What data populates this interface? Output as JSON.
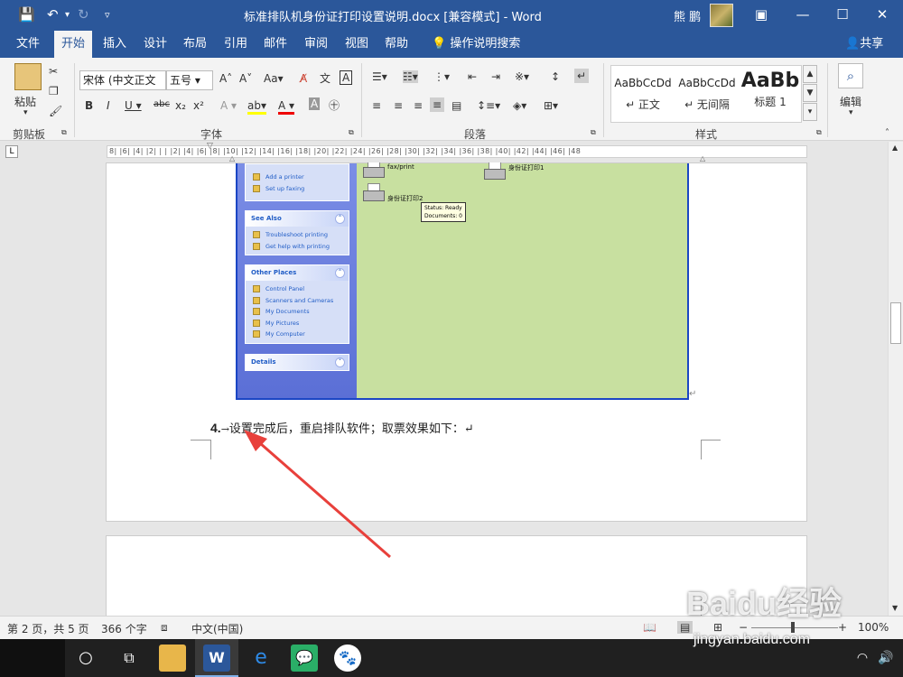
{
  "titlebar": {
    "title": "标准排队机身份证打印设置说明.docx [兼容模式] - Word",
    "user": "熊 鹏",
    "icons": [
      "save-icon",
      "undo-icon",
      "redo-icon",
      "customize-icon",
      "ribbon-display-icon",
      "minimize-icon",
      "maximize-icon",
      "close-icon"
    ]
  },
  "tabs": [
    "文件",
    "开始",
    "插入",
    "设计",
    "布局",
    "引用",
    "邮件",
    "审阅",
    "视图",
    "帮助",
    "操作说明搜索"
  ],
  "share": "共享",
  "ribbon": {
    "clipboard": {
      "paste": "粘贴",
      "label": "剪贴板"
    },
    "font": {
      "name": "宋体 (中文正文",
      "size": "五号",
      "aa": "Aa",
      "label": "字体"
    },
    "paragraph": {
      "label": "段落"
    },
    "styles": {
      "label": "样式",
      "items": [
        {
          "sample": "AaBbCcDd",
          "name": "↵ 正文"
        },
        {
          "sample": "AaBbCcDd",
          "name": "↵ 无间隔"
        },
        {
          "sample": "AaBb",
          "name": "标题 1"
        }
      ]
    },
    "edit": {
      "label": "编辑"
    }
  },
  "ruler": {
    "text": "8| |6| |4| |2| | | |2| |4| |6| |8| |10| |12| |14| |16| |18| |20| |22| |24| |26| |28| |30| |32| |34| |36| |38| |40| |42| |44| |46| |48",
    "corner": "L"
  },
  "xp": {
    "panel1": [
      "Add a printer",
      "Set up faxing"
    ],
    "see_also_title": "See Also",
    "see_also": [
      "Troubleshoot printing",
      "Get help with printing"
    ],
    "other_places_title": "Other Places",
    "other_places": [
      "Control Panel",
      "Scanners and Cameras",
      "My Documents",
      "My Pictures",
      "My Computer"
    ],
    "details_title": "Details",
    "printer1": "fax/print",
    "printer2": "身份证打印1",
    "printer3": "身份证打印2",
    "tooltip_status": "Status: Ready",
    "tooltip_docs": "Documents: 0"
  },
  "document": {
    "para_number": "4.",
    "para_text": "设置完成后，重启排队软件；取票效果如下：↵"
  },
  "statusbar": {
    "page": "第 2 页，共 5 页",
    "words": "366 个字",
    "language": "中文(中国)",
    "zoom": "100%"
  },
  "watermark": {
    "logo": "Baidu经验",
    "url": "jingyan.baidu.com"
  },
  "colors": {
    "word_blue": "#2b579a",
    "arrow_red": "#e8403b"
  }
}
